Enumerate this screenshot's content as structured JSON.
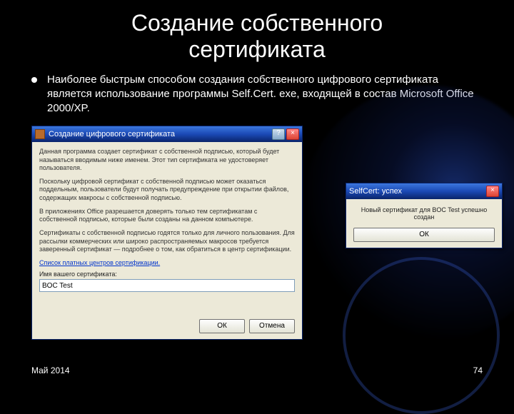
{
  "slide": {
    "title_line1": "Создание собственного",
    "title_line2": "сертификата",
    "bullet": "Наиболее быстрым способом создания собственного цифрового сертификата является использование программы Self.Cert. exe, входящей в состав Microsoft Office 2000/XP."
  },
  "dialog_main": {
    "title": "Создание цифрового сертификата",
    "help_btn": "?",
    "close_btn": "×",
    "para1": "Данная программа создает сертификат с собственной подписью, который будет называться вводимым ниже именем. Этот тип сертификата не удостоверяет пользователя.",
    "para2": "Поскольку цифровой сертификат с собственной подписью может оказаться поддельным, пользователи будут получать предупреждение при открытии файлов, содержащих макросы с собственной подписью.",
    "para3": "В приложениях Office разрешается доверять только тем сертификатам с собственной подписью, которые были созданы на данном компьютере.",
    "para4": "Сертификаты с собственной подписью годятся только для личного пользования. Для рассылки коммерческих или широко распространяемых макросов требуется заверенный сертификат — подробнее о том, как обратиться в центр сертификации.",
    "link": "Список платных центров сертификации.",
    "field_label": "Имя вашего сертификата:",
    "field_value": "BOC Test",
    "ok": "ОК",
    "cancel": "Отмена"
  },
  "dialog_success": {
    "title": "SelfCert: успех",
    "close_btn": "×",
    "message": "Новый сертификат для BOC Test успешно создан",
    "ok": "ОК"
  },
  "footer": {
    "date": "Май 2014",
    "page": "74"
  }
}
